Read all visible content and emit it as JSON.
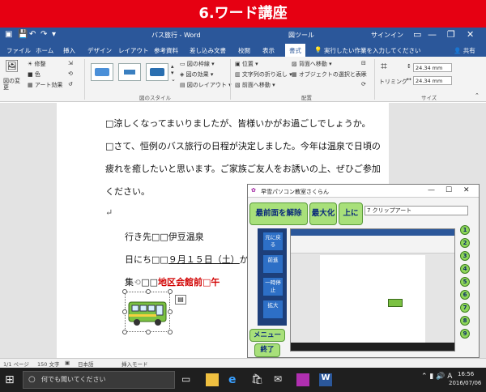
{
  "banner": {
    "text": "6.ワード講座"
  },
  "titlebar": {
    "doc_title": "バス旅行 - Word",
    "context_group": "図ツール",
    "user": "サインイン",
    "minimize": "—",
    "restore": "❐",
    "close": "✕"
  },
  "tabs": [
    {
      "label": "ファイル"
    },
    {
      "label": "ホーム"
    },
    {
      "label": "挿入"
    },
    {
      "label": "デザイン"
    },
    {
      "label": "レイアウト"
    },
    {
      "label": "参考資料"
    },
    {
      "label": "差し込み文書"
    },
    {
      "label": "校閲"
    },
    {
      "label": "表示"
    },
    {
      "label": "書式"
    }
  ],
  "tell_me": "実行したい作業を入力してください",
  "share": "共有",
  "ribbon": {
    "change_picture": "図の変更",
    "correct": "修整",
    "color": "色",
    "artistic": "アート効果",
    "border": "図の枠線",
    "effects": "図の効果",
    "layout": "図のレイアウト",
    "styles_group": "図のスタイル",
    "position": "位置",
    "wrap": "文字列の折り返し",
    "forward": "前面へ移動",
    "backward": "背面へ移動",
    "selection_pane": "オブジェクトの選択と表示",
    "arrange_group": "配置",
    "trim": "トリミング",
    "height": "24.34 mm",
    "width": "24.34 mm",
    "size_group": "サイズ"
  },
  "document": {
    "lines": [
      "□涼しくなってまいりましたが、皆様いかがお過ごしでしょうか。",
      "□さて、恒例のバス旅行の日程が決定しました。今年は温泉で日頃の",
      "疲れを癒したいと思います。ご家族ご友人をお誘いの上、ぜひご参加",
      "ください。"
    ],
    "dest": "行き先□□伊豆温泉",
    "date_prefix": "日にち□□",
    "date": "９月１５日（土）",
    "date_tail": "か",
    "meet_prefix": "集",
    "meet_mid": "□□",
    "meet_place": "地区会館前□午"
  },
  "helper": {
    "title": "早雪パソコン教室さくらん",
    "btn_release": "最前面を解除",
    "btn_max": "最大化",
    "btn_up": "上に",
    "search_value": "7 クリップアート",
    "side_buttons": [
      "元に戻る",
      "前進",
      "一時停止",
      "拡大"
    ],
    "btn_menu": "メニュー",
    "btn_exit": "終了",
    "numbers": [
      "1",
      "2",
      "3",
      "4",
      "5",
      "6",
      "7",
      "8",
      "9"
    ]
  },
  "status": {
    "page": "1/1 ページ",
    "words": "150 文字",
    "lang": "日本語",
    "mode": "挿入モード"
  },
  "taskbar": {
    "search_placeholder": "何でも聞いてください",
    "time": "16:56",
    "date": "2016/07/06"
  }
}
